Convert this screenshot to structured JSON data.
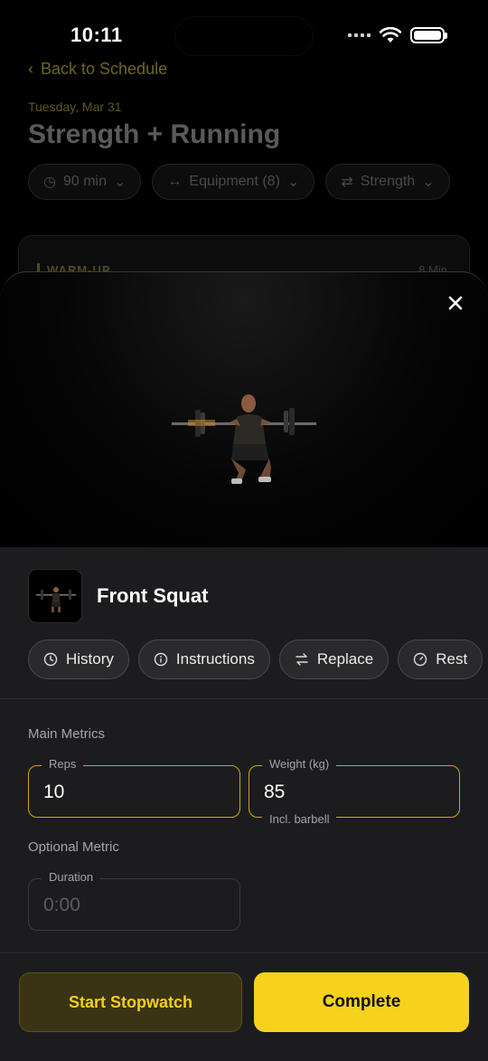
{
  "status_bar": {
    "time": "10:11"
  },
  "background_screen": {
    "back_label": "Back to Schedule",
    "date": "Tuesday, Mar 31",
    "title": "Strength + Running",
    "chips": [
      {
        "icon": "clock-icon",
        "label": "90 min"
      },
      {
        "icon": "dumbbell-icon",
        "label": "Equipment (8)"
      },
      {
        "icon": "swap-icon",
        "label": "Strength"
      }
    ],
    "section_label": "WARM-UP",
    "section_duration": "8 Min"
  },
  "sheet": {
    "exercise_name": "Front Squat",
    "action_chips": [
      {
        "icon": "clock-icon",
        "label": "History"
      },
      {
        "icon": "info-icon",
        "label": "Instructions"
      },
      {
        "icon": "swap-icon",
        "label": "Replace"
      },
      {
        "icon": "timer-icon",
        "label": "Rest"
      }
    ],
    "main_metrics_label": "Main Metrics",
    "reps": {
      "label": "Reps",
      "value": "10"
    },
    "weight": {
      "label": "Weight (kg)",
      "value": "85",
      "hint": "Incl. barbell"
    },
    "optional_metric_label": "Optional Metric",
    "duration": {
      "label": "Duration",
      "placeholder": "0:00"
    }
  },
  "buttons": {
    "start_stopwatch": "Start Stopwatch",
    "complete": "Complete"
  },
  "colors": {
    "accent": "#f6d21c",
    "sheet_bg": "#1c1c1e",
    "active_border": "#c9a90f"
  }
}
